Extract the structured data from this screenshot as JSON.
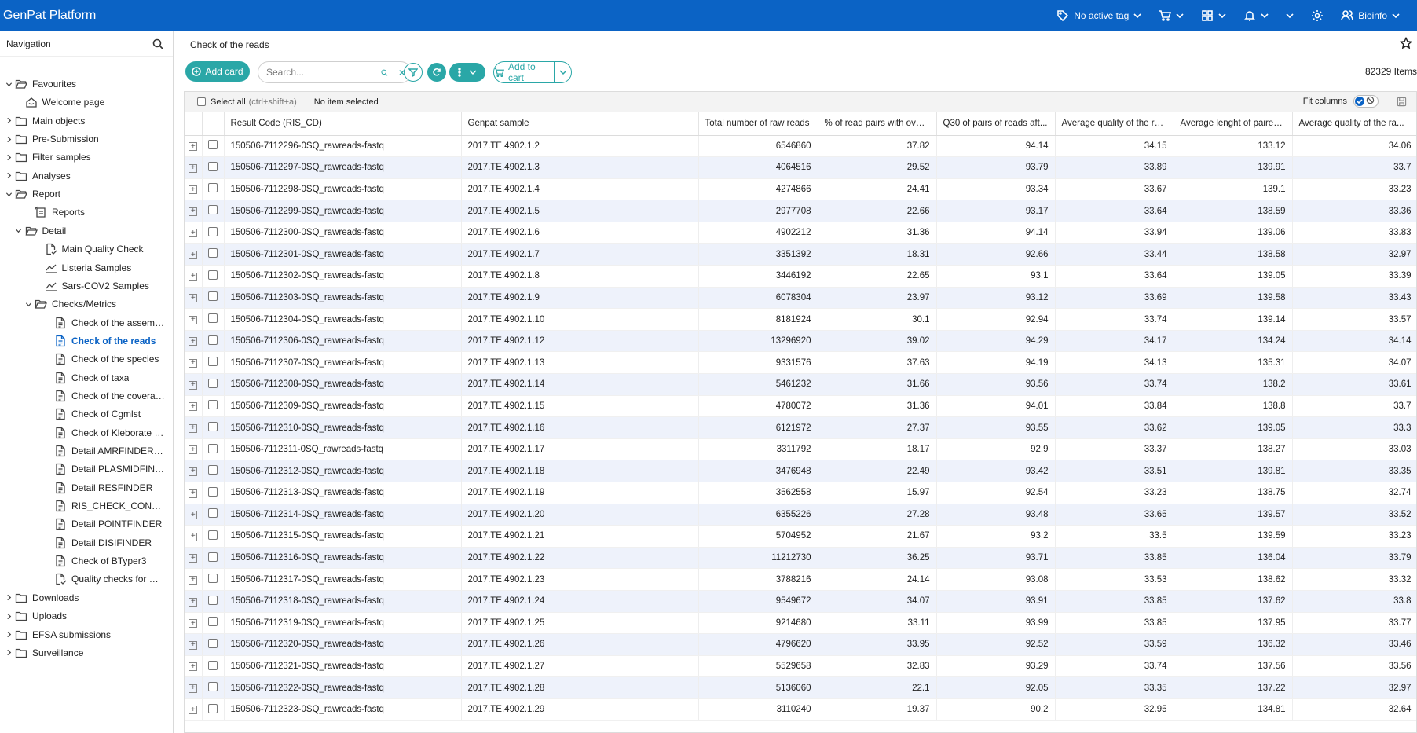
{
  "app": {
    "title": "GenPat Platform"
  },
  "topbar": {
    "tag_label": "No active tag",
    "user_label": "Bioinfo",
    "icons": [
      "tag-icon",
      "cart-icon",
      "apps-icon",
      "bell-icon",
      "chevron-down-icon",
      "gear-icon",
      "user-icon"
    ]
  },
  "sidebar": {
    "title": "Navigation",
    "items": [
      {
        "label": "Favourites",
        "level": 0,
        "icon": "folder-open-icon",
        "toggle": "open"
      },
      {
        "label": "Welcome page",
        "level": 1,
        "icon": "home-icon",
        "toggle": ""
      },
      {
        "label": "Main objects",
        "level": 0,
        "icon": "folder-icon",
        "toggle": "closed"
      },
      {
        "label": "Pre-Submission",
        "level": 0,
        "icon": "folder-icon",
        "toggle": "closed"
      },
      {
        "label": "Filter samples",
        "level": 0,
        "icon": "folder-icon",
        "toggle": "closed"
      },
      {
        "label": "Analyses",
        "level": 0,
        "icon": "folder-icon",
        "toggle": "closed"
      },
      {
        "label": "Report",
        "level": 0,
        "icon": "folder-open-icon",
        "toggle": "open"
      },
      {
        "label": "Reports",
        "level": 2,
        "icon": "report-icon",
        "toggle": ""
      },
      {
        "label": "Detail",
        "level": 1,
        "icon": "folder-open-icon",
        "toggle": "open"
      },
      {
        "label": "Main Quality Check",
        "level": 3,
        "icon": "file-check-icon",
        "toggle": ""
      },
      {
        "label": "Listeria Samples",
        "level": 3,
        "icon": "chart-line-icon",
        "toggle": ""
      },
      {
        "label": "Sars-COV2 Samples",
        "level": 3,
        "icon": "chart-line-icon",
        "toggle": ""
      },
      {
        "label": "Checks/Metrics",
        "level": 2,
        "icon": "folder-open-icon",
        "toggle": "open"
      },
      {
        "label": "Check of the assembly",
        "level": 4,
        "icon": "document-icon",
        "toggle": ""
      },
      {
        "label": "Check of the reads",
        "level": 4,
        "icon": "document-icon",
        "toggle": "",
        "active": true
      },
      {
        "label": "Check of the species",
        "level": 4,
        "icon": "document-icon",
        "toggle": ""
      },
      {
        "label": "Check of taxa",
        "level": 4,
        "icon": "document-icon",
        "toggle": ""
      },
      {
        "label": "Check of the coverage",
        "level": 4,
        "icon": "document-icon",
        "toggle": ""
      },
      {
        "label": "Check of Cgmlst",
        "level": 4,
        "icon": "document-icon",
        "toggle": ""
      },
      {
        "label": "Check of Kleborate (Com...",
        "level": 4,
        "icon": "document-icon",
        "toggle": ""
      },
      {
        "label": "Detail AMRFINDERPLUS",
        "level": 4,
        "icon": "document-icon",
        "toggle": ""
      },
      {
        "label": "Detail PLASMIDFINDER",
        "level": 4,
        "icon": "document-icon",
        "toggle": ""
      },
      {
        "label": "Detail RESFINDER",
        "level": 4,
        "icon": "document-icon",
        "toggle": ""
      },
      {
        "label": "RIS_CHECK_CONTAM",
        "level": 4,
        "icon": "document-icon",
        "toggle": ""
      },
      {
        "label": "Detail POINTFINDER",
        "level": 4,
        "icon": "document-icon",
        "toggle": ""
      },
      {
        "label": "Detail DISIFINDER",
        "level": 4,
        "icon": "document-icon",
        "toggle": ""
      },
      {
        "label": "Check of BTyper3",
        "level": 4,
        "icon": "document-icon",
        "toggle": ""
      },
      {
        "label": "Quality checks for ML-ba...",
        "level": 4,
        "icon": "file-check-icon",
        "toggle": ""
      },
      {
        "label": "Downloads",
        "level": 0,
        "icon": "folder-icon",
        "toggle": "closed"
      },
      {
        "label": "Uploads",
        "level": 0,
        "icon": "folder-icon",
        "toggle": "closed"
      },
      {
        "label": "EFSA submissions",
        "level": 0,
        "icon": "folder-icon",
        "toggle": "closed"
      },
      {
        "label": "Surveillance",
        "level": 0,
        "icon": "folder-icon",
        "toggle": "closed"
      }
    ]
  },
  "main": {
    "title": "Check of the reads",
    "add_card_label": "Add card",
    "search_placeholder": "Search...",
    "add_to_cart_label": "Add to cart",
    "items_count": "82329 Items",
    "select_all_label": "Select all",
    "select_all_shortcut": "(ctrl+shift+a)",
    "selection_status": "No item selected",
    "fit_columns_label": "Fit columns"
  },
  "table": {
    "columns": [
      "Result Code (RIS_CD)",
      "Genpat sample",
      "Total number of raw reads",
      "% of read pairs with overl...",
      "Q30 of pairs of reads aft...",
      "Average quality of the re...",
      "Average lenght of paired...",
      "Average quality of the ra..."
    ],
    "rows": [
      [
        "150506-7112296-0SQ_rawreads-fastq",
        "2017.TE.4902.1.2",
        "6546860",
        "37.82",
        "94.14",
        "34.15",
        "133.12",
        "34.06"
      ],
      [
        "150506-7112297-0SQ_rawreads-fastq",
        "2017.TE.4902.1.3",
        "4064516",
        "29.52",
        "93.79",
        "33.89",
        "139.91",
        "33.7"
      ],
      [
        "150506-7112298-0SQ_rawreads-fastq",
        "2017.TE.4902.1.4",
        "4274866",
        "24.41",
        "93.34",
        "33.67",
        "139.1",
        "33.23"
      ],
      [
        "150506-7112299-0SQ_rawreads-fastq",
        "2017.TE.4902.1.5",
        "2977708",
        "22.66",
        "93.17",
        "33.64",
        "138.59",
        "33.36"
      ],
      [
        "150506-7112300-0SQ_rawreads-fastq",
        "2017.TE.4902.1.6",
        "4902212",
        "31.36",
        "94.14",
        "33.94",
        "139.06",
        "33.83"
      ],
      [
        "150506-7112301-0SQ_rawreads-fastq",
        "2017.TE.4902.1.7",
        "3351392",
        "18.31",
        "92.66",
        "33.44",
        "138.58",
        "32.97"
      ],
      [
        "150506-7112302-0SQ_rawreads-fastq",
        "2017.TE.4902.1.8",
        "3446192",
        "22.65",
        "93.1",
        "33.64",
        "139.05",
        "33.39"
      ],
      [
        "150506-7112303-0SQ_rawreads-fastq",
        "2017.TE.4902.1.9",
        "6078304",
        "23.97",
        "93.12",
        "33.69",
        "139.58",
        "33.43"
      ],
      [
        "150506-7112304-0SQ_rawreads-fastq",
        "2017.TE.4902.1.10",
        "8181924",
        "30.1",
        "92.94",
        "33.74",
        "139.14",
        "33.57"
      ],
      [
        "150506-7112306-0SQ_rawreads-fastq",
        "2017.TE.4902.1.12",
        "13296920",
        "39.02",
        "94.29",
        "34.17",
        "134.24",
        "34.14"
      ],
      [
        "150506-7112307-0SQ_rawreads-fastq",
        "2017.TE.4902.1.13",
        "9331576",
        "37.63",
        "94.19",
        "34.13",
        "135.31",
        "34.07"
      ],
      [
        "150506-7112308-0SQ_rawreads-fastq",
        "2017.TE.4902.1.14",
        "5461232",
        "31.66",
        "93.56",
        "33.74",
        "138.2",
        "33.61"
      ],
      [
        "150506-7112309-0SQ_rawreads-fastq",
        "2017.TE.4902.1.15",
        "4780072",
        "31.36",
        "94.01",
        "33.84",
        "138.8",
        "33.7"
      ],
      [
        "150506-7112310-0SQ_rawreads-fastq",
        "2017.TE.4902.1.16",
        "6121972",
        "27.37",
        "93.55",
        "33.62",
        "139.05",
        "33.3"
      ],
      [
        "150506-7112311-0SQ_rawreads-fastq",
        "2017.TE.4902.1.17",
        "3311792",
        "18.17",
        "92.9",
        "33.37",
        "138.27",
        "33.03"
      ],
      [
        "150506-7112312-0SQ_rawreads-fastq",
        "2017.TE.4902.1.18",
        "3476948",
        "22.49",
        "93.42",
        "33.51",
        "139.81",
        "33.35"
      ],
      [
        "150506-7112313-0SQ_rawreads-fastq",
        "2017.TE.4902.1.19",
        "3562558",
        "15.97",
        "92.54",
        "33.23",
        "138.75",
        "32.74"
      ],
      [
        "150506-7112314-0SQ_rawreads-fastq",
        "2017.TE.4902.1.20",
        "6355226",
        "27.28",
        "93.48",
        "33.65",
        "139.57",
        "33.52"
      ],
      [
        "150506-7112315-0SQ_rawreads-fastq",
        "2017.TE.4902.1.21",
        "5704952",
        "21.67",
        "93.2",
        "33.5",
        "139.59",
        "33.23"
      ],
      [
        "150506-7112316-0SQ_rawreads-fastq",
        "2017.TE.4902.1.22",
        "11212730",
        "36.25",
        "93.71",
        "33.85",
        "136.04",
        "33.79"
      ],
      [
        "150506-7112317-0SQ_rawreads-fastq",
        "2017.TE.4902.1.23",
        "3788216",
        "24.14",
        "93.08",
        "33.53",
        "138.62",
        "33.32"
      ],
      [
        "150506-7112318-0SQ_rawreads-fastq",
        "2017.TE.4902.1.24",
        "9549672",
        "34.07",
        "93.91",
        "33.85",
        "137.62",
        "33.8"
      ],
      [
        "150506-7112319-0SQ_rawreads-fastq",
        "2017.TE.4902.1.25",
        "9214680",
        "33.11",
        "93.99",
        "33.85",
        "137.95",
        "33.77"
      ],
      [
        "150506-7112320-0SQ_rawreads-fastq",
        "2017.TE.4902.1.26",
        "4796620",
        "33.95",
        "92.52",
        "33.59",
        "136.32",
        "33.46"
      ],
      [
        "150506-7112321-0SQ_rawreads-fastq",
        "2017.TE.4902.1.27",
        "5529658",
        "32.83",
        "93.29",
        "33.74",
        "137.56",
        "33.56"
      ],
      [
        "150506-7112322-0SQ_rawreads-fastq",
        "2017.TE.4902.1.28",
        "5136060",
        "22.1",
        "92.05",
        "33.35",
        "137.22",
        "32.97"
      ],
      [
        "150506-7112323-0SQ_rawreads-fastq",
        "2017.TE.4902.1.29",
        "3110240",
        "19.37",
        "90.2",
        "32.95",
        "134.81",
        "32.64"
      ]
    ]
  },
  "colors": {
    "brand": "#0b63c5",
    "accent": "#2aa7a7",
    "row_stripe": "#eef2fb"
  }
}
